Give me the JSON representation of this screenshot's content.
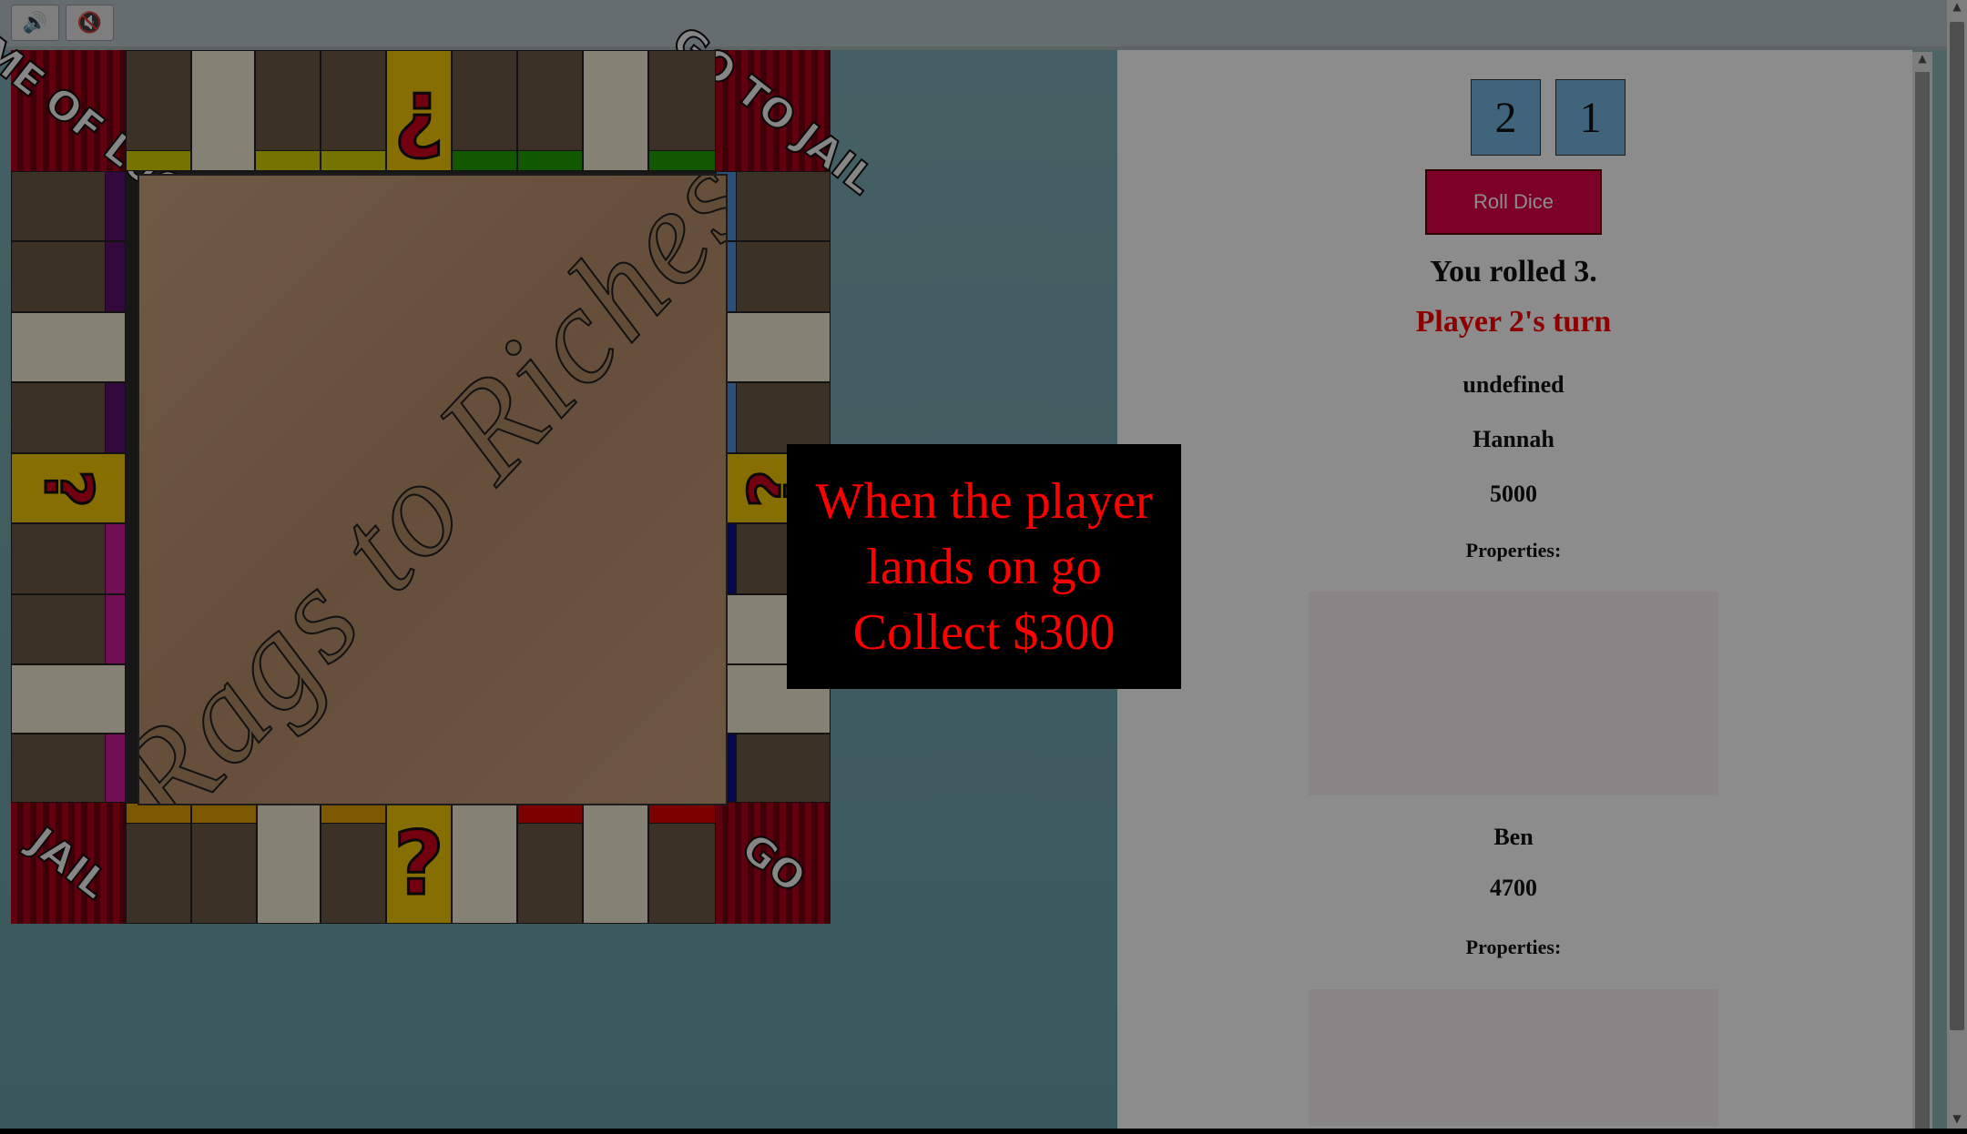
{
  "toolbar": {
    "sound_on": "🔊",
    "sound_off": "🔇"
  },
  "board": {
    "title": "Rags to Riches",
    "corners": {
      "top_left": "GAME OF LUCK",
      "top_right": "GO TO JAIL",
      "bottom_left": "JAIL",
      "bottom_right": "GO"
    },
    "chance_symbol": "?",
    "inverted_chance_symbol": "¿",
    "colors": {
      "yellow": "#d6d400",
      "green": "#22a000",
      "purple": "#5b0f6f",
      "magenta": "#cf1d9a",
      "light_blue": "#4f8fe0",
      "navy": "#0c0f8f",
      "orange": "#e2a200",
      "red": "#e30000"
    }
  },
  "popup": {
    "line1": "When the player",
    "line2": "lands on go",
    "line3": "Collect $300"
  },
  "dice": {
    "die1": "2",
    "die2": "1"
  },
  "controls": {
    "roll_label": "Roll Dice"
  },
  "status": {
    "rolled": "You rolled 3.",
    "turn": "Player 2's turn",
    "misc": "undefined"
  },
  "players": [
    {
      "name": "Hannah",
      "money": "5000",
      "properties_label": "Properties:"
    },
    {
      "name": "Ben",
      "money": "4700",
      "properties_label": "Properties:"
    }
  ]
}
